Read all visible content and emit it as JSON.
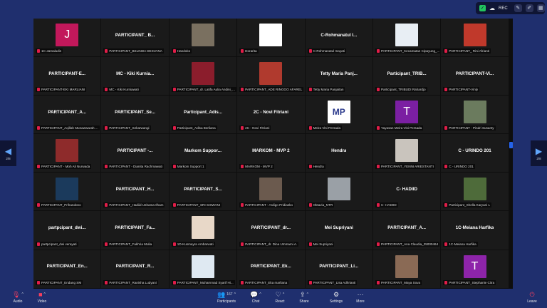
{
  "recording": {
    "label": "REC",
    "icons": [
      "shield-icon",
      "cloud-icon",
      "pencil-icon",
      "annotate-icon",
      "grid-icon"
    ]
  },
  "nav": {
    "left_page": "2/8",
    "right_page": "2/8"
  },
  "tiles": [
    {
      "title": "",
      "avatar": "J",
      "avatar_color": "#c2185b",
      "name": "1C-Jamaludin"
    },
    {
      "title": "PARTICIPANT_ B...",
      "name": "PARTICIPANT_BELINDA DESVANA"
    },
    {
      "title": "",
      "photo": "#7a7060",
      "name": "Handoko"
    },
    {
      "title": "",
      "photo": "#ffffff",
      "name": "Dorarita"
    },
    {
      "title": "C-Rohmanatul I...",
      "name": "C-Rohmanatul Inayati"
    },
    {
      "title": "",
      "photo": "#e8eef4",
      "name": "PARTICIPANT_Kecamatan Cipayung_..."
    },
    {
      "title": "",
      "photo": "#c0392b",
      "name": "PARTICIPANT_ Rini Afrianti"
    },
    {
      "title": "PARTICIPANT-E...",
      "name": "PARTICIPANT-EKI MARLIANI"
    },
    {
      "title": "MC - Kiki Kurnia...",
      "name": "MC - Kiki Kurniawati"
    },
    {
      "title": "",
      "photo": "#8b1d2c",
      "name": "PARTICIPANT_dr. Latifa Aulia Andini_..."
    },
    {
      "title": "",
      "photo": "#b03a2e",
      "name": "PARTICIPANT_ADE RINGGO AFAREL"
    },
    {
      "title": "Tetty Maria Panj...",
      "name": "Tetty Maria Panjaitan"
    },
    {
      "title": "Participant_TRIB...",
      "name": "Participant_TRIBUDI Rahardjo"
    },
    {
      "title": "PARTICIPANT-Vi...",
      "name": "PARTICIPANT-Vinly"
    },
    {
      "title": "PARTICIPANT_A...",
      "name": "PARTICIPANT_Aqillah Munawwarah ..."
    },
    {
      "title": "PARTICIPANT_Se...",
      "name": "PARTICIPANT_Sekarwangi"
    },
    {
      "title": "Participant_Adis...",
      "name": "Participant_Adisa Berliana"
    },
    {
      "title": "2C - Novi Fitriani",
      "name": "2C - Novi Fitriani"
    },
    {
      "title": "",
      "photo": "#ffffff",
      "logo": "MP",
      "name": "Meira Visi Persada"
    },
    {
      "title": "",
      "avatar": "T",
      "avatar_color": "#7b1fa2",
      "name": "Yayasan Meira Visi Persada"
    },
    {
      "title": "",
      "photo": "#6b7b5e",
      "name": "PARTICIPANT - Pindri Susanty"
    },
    {
      "title": "",
      "photo": "#8e2b2b",
      "name": "PARTICIPANT - Moh Ali Nurwada"
    },
    {
      "title": "PARTICIPANT -...",
      "name": "PARTICIPANT - Dianita Rachmawati"
    },
    {
      "title": "Markom Suppor...",
      "name": "Markom Support 1"
    },
    {
      "title": "MARKOM - MVP 2",
      "name": "MARKOM - MVP 2"
    },
    {
      "title": "Hendra",
      "name": "Hendra"
    },
    {
      "title": "",
      "photo": "#c9c4bd",
      "name": "PARTICIPANT_YENNI ARIESTANTI"
    },
    {
      "title": "C - URINDO 201",
      "name": "C - URINDO 201"
    },
    {
      "title": "",
      "avatar": "",
      "avatar_color": "#1b3a5c",
      "name": "PARTICIPANT_Prihandono"
    },
    {
      "title": "PARTICIPANT_H...",
      "name": "PARTICIPANT_Hadiid Ushama Ilham"
    },
    {
      "title": "PARTICIPANT_S...",
      "name": "PARTICIPANT_SRI SISWANI"
    },
    {
      "title": "",
      "photo": "#6b5a4e",
      "name": "PARTICIPANT - Ardigo Pridiasko"
    },
    {
      "title": "",
      "photo": "#9aa0a6",
      "name": "Oktavia_NTR"
    },
    {
      "title": "C- HADIID",
      "name": "C- HADIID"
    },
    {
      "title": "",
      "photo": "#4e6b3a",
      "name": "Participant_Shella Karyani L"
    },
    {
      "title": "partpcipant_dwi...",
      "name": "partpcipant_dwi verayati"
    },
    {
      "title": "PARTICIPANT_Fa...",
      "name": "PARTICIPANT_Fakhria Mulia"
    },
    {
      "title": "",
      "photo": "#e8d8c8",
      "name": "1D-Kusmayra Ambarwati"
    },
    {
      "title": "PARTICIPANT_dr...",
      "name": "PARTICIPANT_dr. Dina Ummami A."
    },
    {
      "title": "Mei Supriyani",
      "name": "Mei Supriyani"
    },
    {
      "title": "PARTICIPANT_A...",
      "name": "PARTICIPANT_Ana Claudia_25000464"
    },
    {
      "title": "1C-Meiana Harfika",
      "name": "1C-Meiana Harfika"
    },
    {
      "title": "PARTICIPANT_En...",
      "name": "PARTICIPANT_Endang SM"
    },
    {
      "title": "PARTICIPANT_R...",
      "name": "PARTICIPANT_Ranisha Ludyani"
    },
    {
      "title": "",
      "photo": "#dfe9f2",
      "name": "PARTICIPANT_Muhammad Syarif Hi..."
    },
    {
      "title": "PARTICIPANT_Ek...",
      "name": "PARTICIPANT_Eka marliana"
    },
    {
      "title": "PARTICIPANT_Li...",
      "name": "PARTICIPANT_Lisa Adhrianti"
    },
    {
      "title": "",
      "photo": "#8a6a55",
      "name": "PARTICIPANT_Maya Sova"
    },
    {
      "title": "",
      "avatar": "T",
      "avatar_color": "#8e24aa",
      "name": "PARTICIPANT_Stephanie Citra"
    }
  ],
  "toolbar": {
    "audio": "Audio",
    "video": "Video",
    "participants": "Participants",
    "participant_count": "167",
    "chat": "Chat",
    "react": "React",
    "share": "Share",
    "settings": "Settings",
    "more": "More",
    "leave": "Leave"
  }
}
